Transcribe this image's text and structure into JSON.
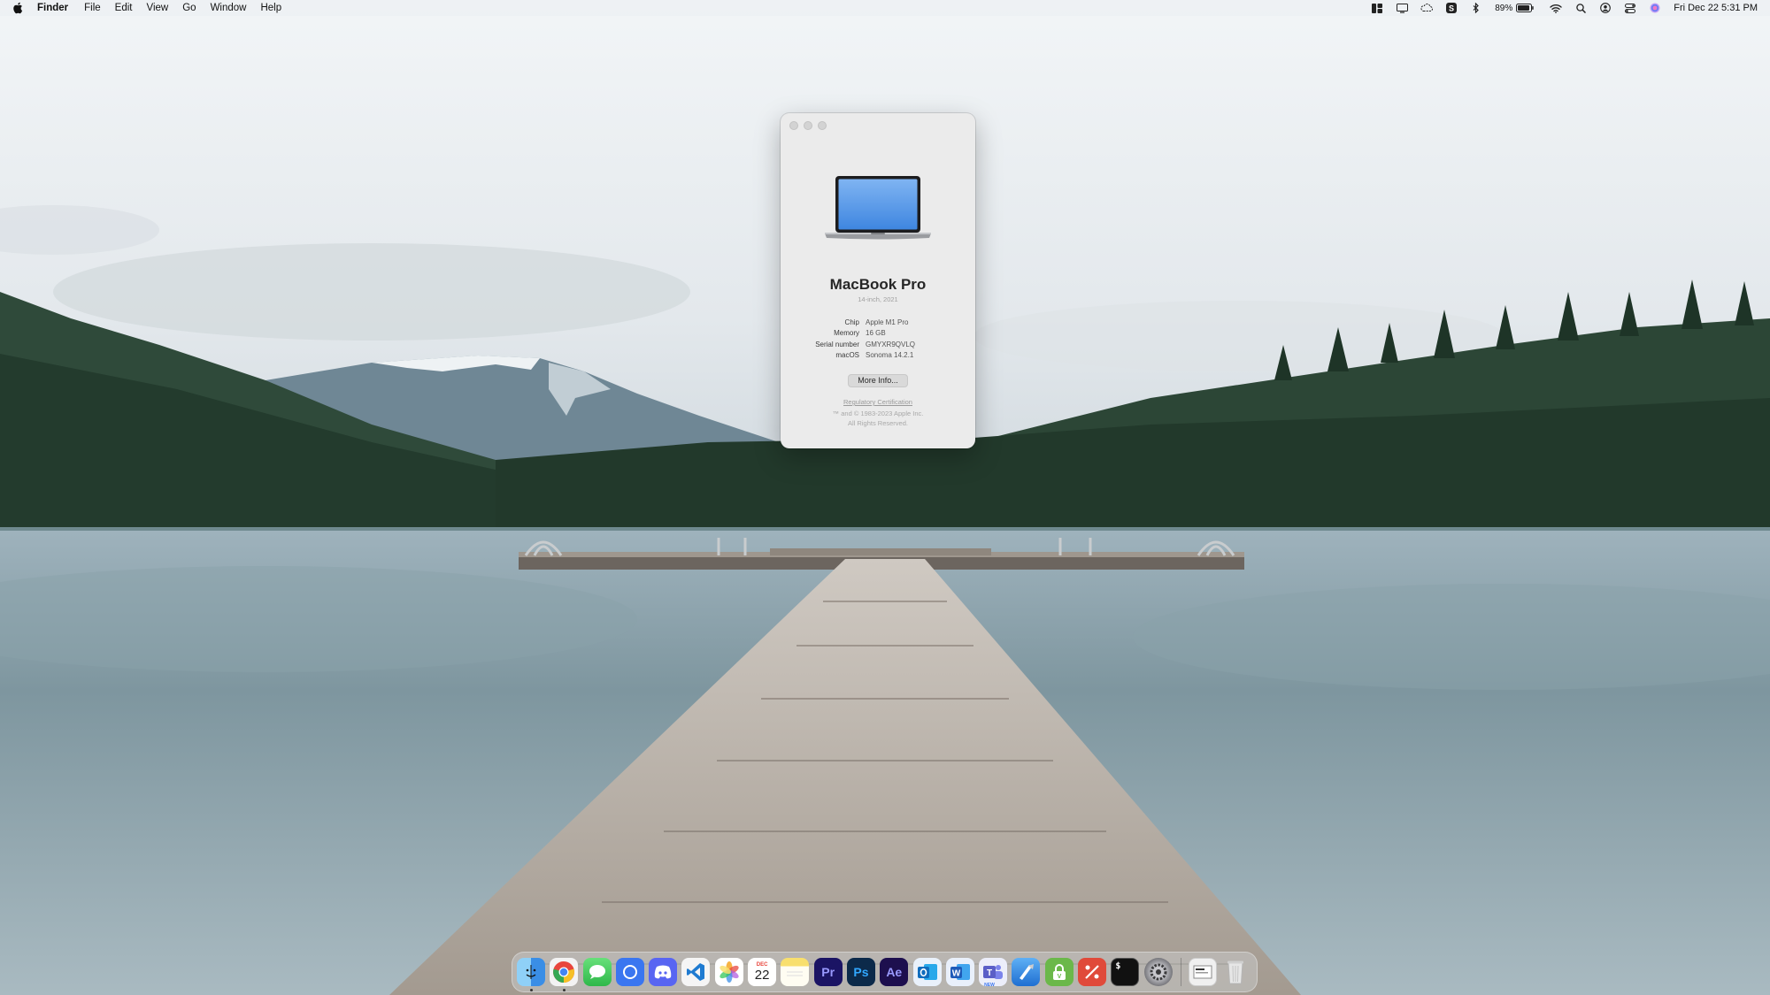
{
  "menubar": {
    "apple_icon": "apple-logo-icon",
    "items": [
      "Finder",
      "File",
      "Edit",
      "View",
      "Go",
      "Window",
      "Help"
    ],
    "status_icons": [
      "stage-manager-icon",
      "display-icon",
      "cloud-icon",
      "s-app-icon",
      "bluetooth-icon"
    ],
    "battery_text": "89%",
    "status_icons_right": [
      "wifi-icon",
      "spotlight-search-icon",
      "user-icon",
      "control-center-icon",
      "siri-icon"
    ],
    "clock": "Fri Dec 22  5:31 PM"
  },
  "about_window": {
    "model_name": "MacBook Pro",
    "model_sub": "14-inch, 2021",
    "specs": [
      {
        "label": "Chip",
        "value": "Apple M1 Pro"
      },
      {
        "label": "Memory",
        "value": "16 GB"
      },
      {
        "label": "Serial number",
        "value": "GMYXR9QVLQ"
      },
      {
        "label": "macOS",
        "value": "Sonoma 14.2.1"
      }
    ],
    "more_info_button": "More Info...",
    "regulatory_link": "Regulatory Certification",
    "copyright_line1": "™ and © 1983-2023 Apple Inc.",
    "copyright_line2": "All Rights Reserved."
  },
  "dock": {
    "items": [
      {
        "name": "finder",
        "icon": "finder-icon",
        "color": "#3a8ee6",
        "glyph": "☺",
        "running": true
      },
      {
        "name": "chrome",
        "icon": "chrome-icon",
        "color": "#e8453c",
        "glyph": "",
        "running": true
      },
      {
        "name": "messages",
        "icon": "messages-icon",
        "color": "#34c759",
        "glyph": "",
        "running": false
      },
      {
        "name": "signal",
        "icon": "signal-icon",
        "color": "#3a76f0",
        "glyph": "",
        "running": false
      },
      {
        "name": "discord",
        "icon": "discord-icon",
        "color": "#5865f2",
        "glyph": "",
        "running": false
      },
      {
        "name": "vscode",
        "icon": "vscode-icon",
        "color": "#1f7bd1",
        "glyph": "",
        "running": false
      },
      {
        "name": "photos",
        "icon": "photos-icon",
        "color": "#f5a623",
        "glyph": "",
        "running": false
      },
      {
        "name": "calendar",
        "icon": "calendar-icon",
        "color": "#ffffff",
        "glyph": "22",
        "running": false
      },
      {
        "name": "notes",
        "icon": "notes-icon",
        "color": "#f8df6e",
        "glyph": "",
        "running": false
      },
      {
        "name": "premiere",
        "icon": "premiere-pro-icon",
        "color": "#1b1464",
        "glyph": "Pr",
        "running": false
      },
      {
        "name": "photoshop",
        "icon": "photoshop-icon",
        "color": "#0c2a4a",
        "glyph": "Ps",
        "running": false
      },
      {
        "name": "aftereffects",
        "icon": "after-effects-icon",
        "color": "#1d0f4e",
        "glyph": "Ae",
        "running": false
      },
      {
        "name": "outlook",
        "icon": "outlook-icon",
        "color": "#0f6cbd",
        "glyph": "",
        "running": false
      },
      {
        "name": "word",
        "icon": "word-icon",
        "color": "#1e5bb8",
        "glyph": "W",
        "running": false
      },
      {
        "name": "teams",
        "icon": "teams-icon",
        "color": "#5b5fc7",
        "glyph": "",
        "running": false
      },
      {
        "name": "xcode",
        "icon": "xcode-icon",
        "color": "#2b7fd6",
        "glyph": "",
        "running": false
      },
      {
        "name": "vpn",
        "icon": "vpn-lock-icon",
        "color": "#6bb84a",
        "glyph": "",
        "running": false
      },
      {
        "name": "git-client",
        "icon": "git-client-icon",
        "color": "#e04a3a",
        "glyph": "",
        "running": false
      },
      {
        "name": "terminal",
        "icon": "terminal-icon",
        "color": "#111111",
        "glyph": "$",
        "running": false
      },
      {
        "name": "system-settings",
        "icon": "system-settings-icon",
        "color": "#8e8e93",
        "glyph": "",
        "running": false
      }
    ],
    "extra_items": [
      {
        "name": "screenshot-preview",
        "icon": "screenshot-preview-icon",
        "color": "#f0f0f0"
      },
      {
        "name": "trash",
        "icon": "trash-icon",
        "color": "#dcdcdc"
      }
    ]
  }
}
